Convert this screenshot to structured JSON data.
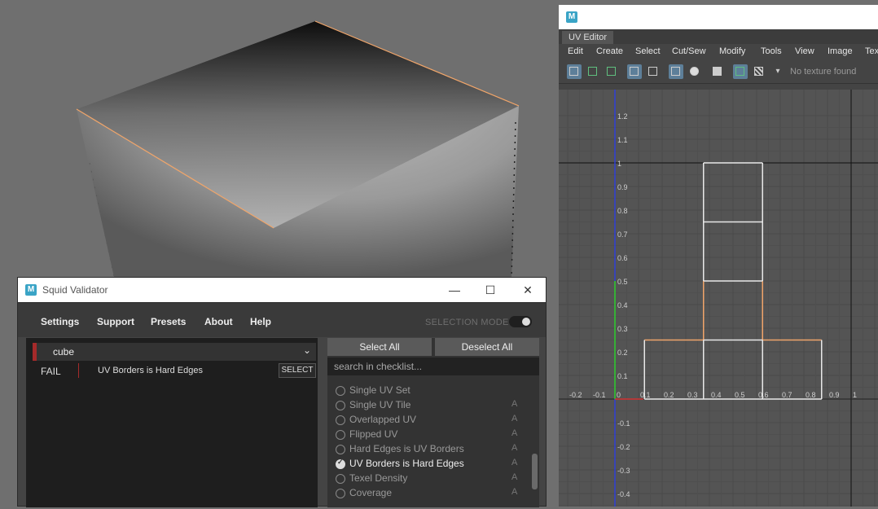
{
  "uv_editor": {
    "logo": "M",
    "tab": "UV Editor",
    "menus": [
      "Edit",
      "Create",
      "Select",
      "Cut/Sew",
      "Modify",
      "Tools",
      "View",
      "Image",
      "Tex"
    ],
    "no_texture": "No texture found",
    "axis_ticks": {
      "y": [
        "1.2",
        "1.1",
        "1",
        "0.9",
        "0.8",
        "0.7",
        "0.6",
        "0.5",
        "0.4",
        "0.3",
        "0.2",
        "0.1",
        "-0.1",
        "-0.2",
        "-0.3",
        "-0.4"
      ],
      "x": [
        "-0.2",
        "-0.1",
        "0",
        "0.1",
        "0.2",
        "0.3",
        "0.4",
        "0.5",
        "0.6",
        "0.7",
        "0.8",
        "0.9",
        "1"
      ]
    },
    "colors": {
      "uv_border": "#f0a56a",
      "uv_edge": "#e8e8e8",
      "v_axis": "#2e3ed6",
      "u_axis": "#d23030",
      "origin_v": "#2ccf2c"
    }
  },
  "validator": {
    "logo": "M",
    "title": "Squid Validator",
    "menus": [
      "Settings",
      "Support",
      "Presets",
      "About",
      "Help"
    ],
    "selection_mode": "SELECTION MODE",
    "object": "cube",
    "result": {
      "status": "FAIL",
      "rule": "UV Borders is Hard Edges",
      "button": "SELECT"
    },
    "select_all": "Select All",
    "deselect_all": "Deselect All",
    "search_placeholder": "search in checklist...",
    "checklist": [
      {
        "label": "Single UV Set",
        "tag": "",
        "checked": false
      },
      {
        "label": "Single UV Tile",
        "tag": "A",
        "checked": false
      },
      {
        "label": "Overlapped UV",
        "tag": "A",
        "checked": false
      },
      {
        "label": "Flipped UV",
        "tag": "A",
        "checked": false
      },
      {
        "label": "Hard Edges is UV Borders",
        "tag": "A",
        "checked": false
      },
      {
        "label": "UV Borders is Hard Edges",
        "tag": "A",
        "checked": true
      },
      {
        "label": "Texel Density",
        "tag": "A",
        "checked": false
      },
      {
        "label": "Coverage",
        "tag": "A",
        "checked": false
      }
    ],
    "colors": {
      "fail_accent": "#a52a2a"
    }
  }
}
